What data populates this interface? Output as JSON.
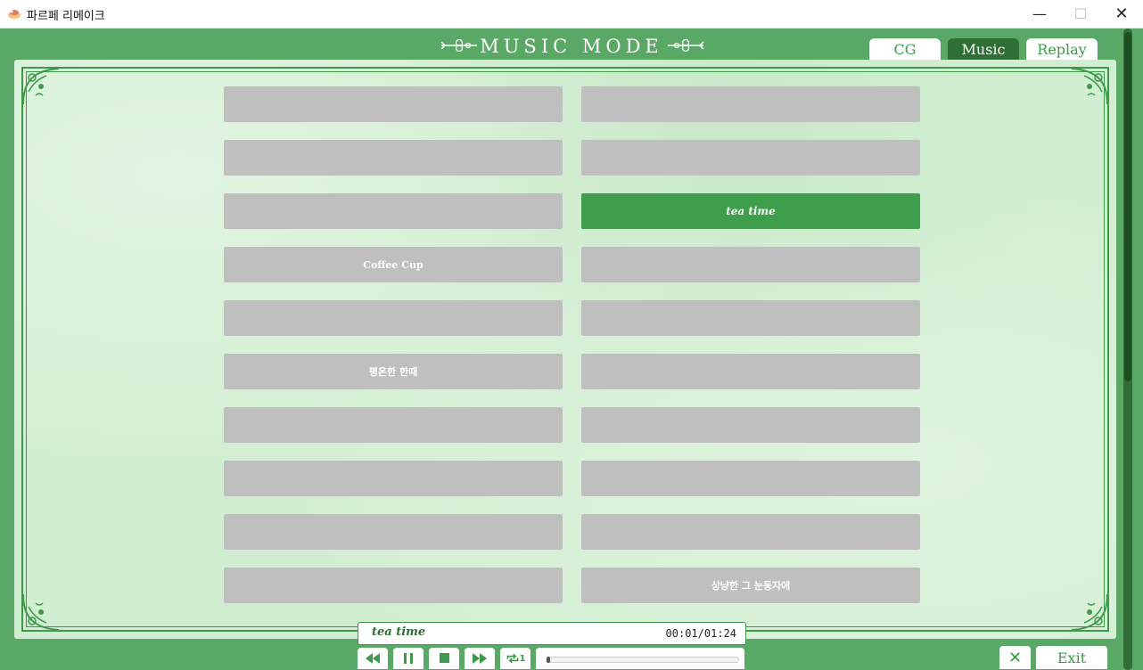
{
  "window": {
    "title": "파르페 리메이크",
    "controls": {
      "minimize": "—",
      "maximize": "☐",
      "close": "✕"
    }
  },
  "header": {
    "title": "MUSIC MODE",
    "tabs": [
      {
        "label": "CG",
        "active": false
      },
      {
        "label": "Music",
        "active": true
      },
      {
        "label": "Replay",
        "active": false
      }
    ]
  },
  "tracks": {
    "left": [
      "",
      "",
      "",
      "Coffee Cup",
      "",
      "평온한 한때",
      "",
      "",
      "",
      ""
    ],
    "right": [
      "",
      "",
      "tea time",
      "",
      "",
      "",
      "",
      "",
      "",
      "상냥한 그 눈동자에"
    ],
    "selected": "tea time"
  },
  "player": {
    "now_playing": "tea time",
    "time": "00:01/01:24",
    "progress_fraction": 0.012,
    "buttons": [
      "rewind",
      "pause",
      "stop",
      "fast-forward",
      "repeat-one"
    ],
    "repeat_label": "1"
  },
  "footer": {
    "close_label": "✕",
    "exit_label": "Exit"
  },
  "colors": {
    "frame_green": "#5aa865",
    "accent_green": "#3f9e4c",
    "dark_green": "#2f6e34",
    "panel_bg": "#d2eed2",
    "empty_slot": "#bfbfbf"
  }
}
